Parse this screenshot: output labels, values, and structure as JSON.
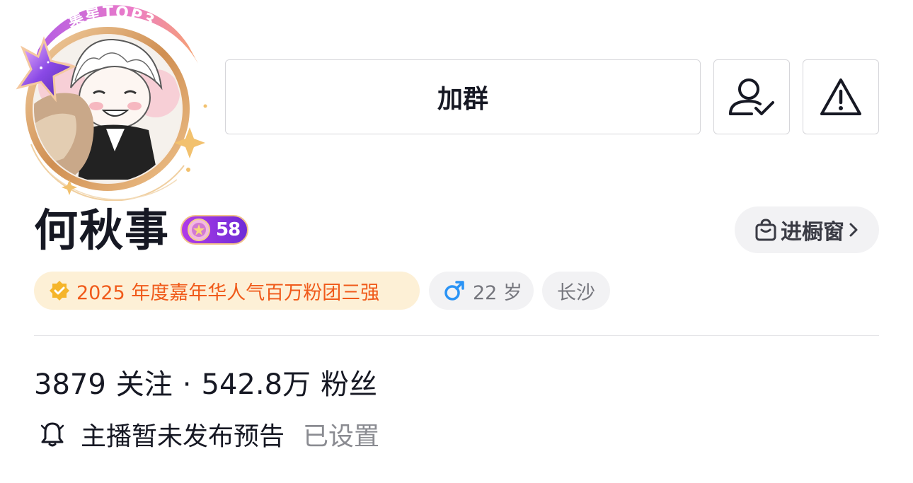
{
  "avatar": {
    "badge_text": "集星TOP3",
    "ring_color": "#d9a16a",
    "banner_color": "#e67bd0"
  },
  "actions": {
    "join_group_label": "加群",
    "follow_icon": "user-check-icon",
    "report_icon": "warning-icon"
  },
  "profile": {
    "name": "何秋事",
    "level": "58",
    "shop_label": "进橱窗"
  },
  "tags": {
    "honor": "2025 年度嘉年华人气百万粉团三强",
    "gender_icon": "male-icon",
    "age": "22 岁",
    "city": "长沙"
  },
  "stats": {
    "following_count": "3879",
    "following_label": "关注",
    "separator": "·",
    "followers_count": "542.8万",
    "followers_label": "粉丝"
  },
  "notice": {
    "text": "主播暂未发布预告",
    "action": "已设置"
  },
  "colors": {
    "honor_text": "#f05a1a",
    "honor_bg": "#fdf0d6",
    "level_badge": "#8a33e0",
    "male_blue": "#2a93f5"
  }
}
